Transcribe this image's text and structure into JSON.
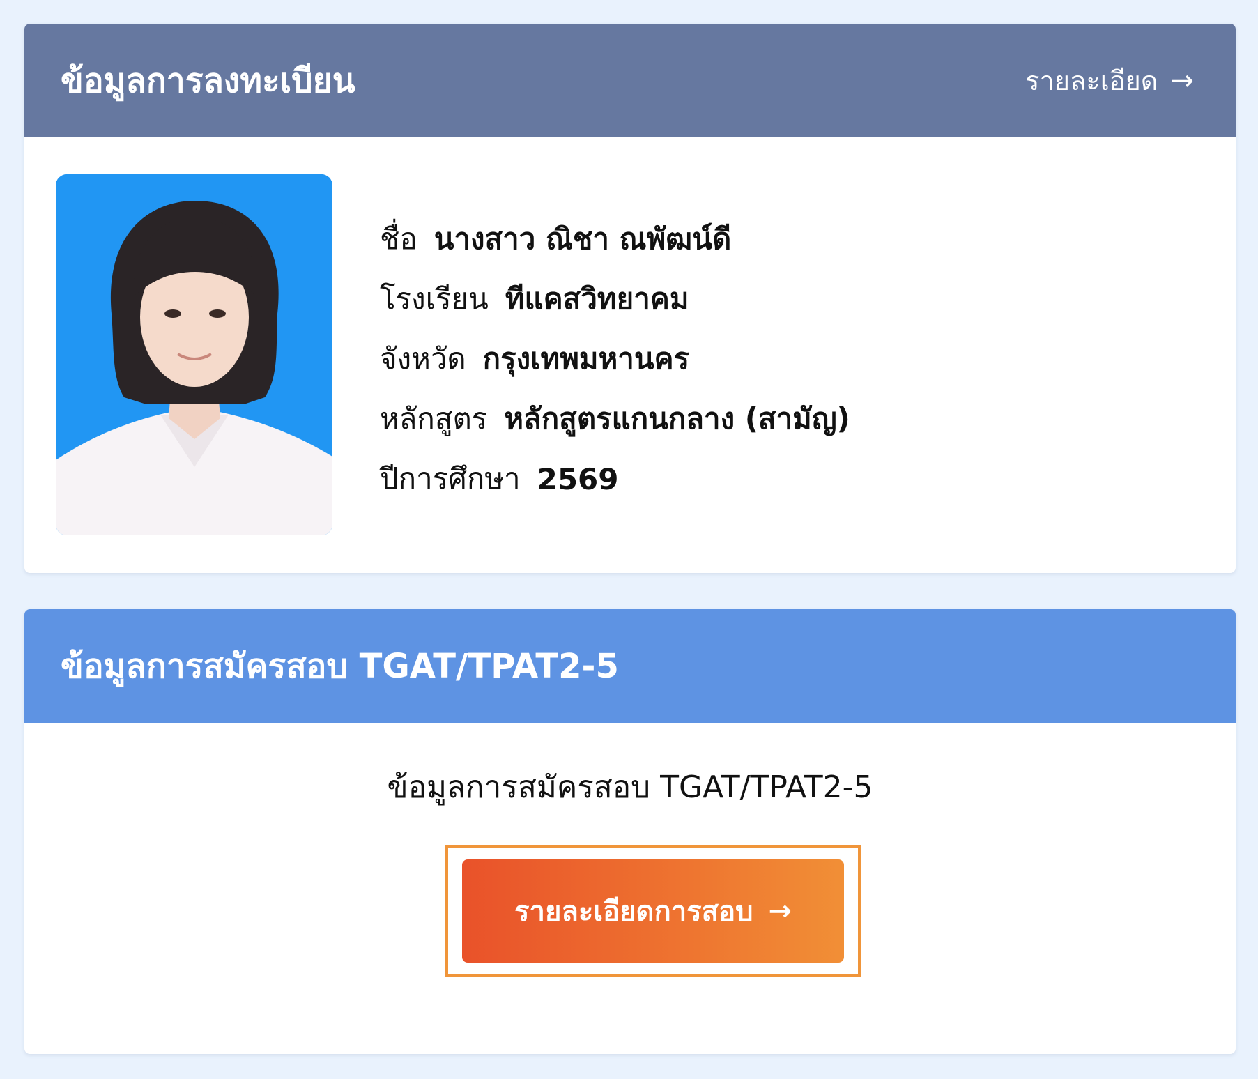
{
  "registration": {
    "title": "ข้อมูลการลงทะเบียน",
    "detail_link": "รายละเอียด",
    "fields": [
      {
        "label": "ชื่อ",
        "value": "นางสาว ณิชา ณพัฒน์ดี"
      },
      {
        "label": "โรงเรียน",
        "value": "ทีแคสวิทยาคม"
      },
      {
        "label": "จังหวัด",
        "value": "กรุงเทพมหานคร"
      },
      {
        "label": "หลักสูตร",
        "value": "หลักสูตรแกนกลาง (สามัญ)"
      },
      {
        "label": "ปีการศึกษา",
        "value": "2569"
      }
    ]
  },
  "exam": {
    "title": "ข้อมูลการสมัครสอบ TGAT/TPAT2-5",
    "caption": "ข้อมูลการสมัครสอบ TGAT/TPAT2-5",
    "button_label": "รายละเอียดการสอบ"
  },
  "icons": {
    "arrow": "arrow-right-icon",
    "arrow_glyph": "→"
  },
  "colors": {
    "page_bg": "#e9f2fd",
    "registration_header": "#6678a0",
    "exam_header": "#5e93e3",
    "button_gradient_start": "#e9522a",
    "button_gradient_end": "#f18f36",
    "button_frame": "#f0953a",
    "photo_bg": "#2196f3"
  }
}
